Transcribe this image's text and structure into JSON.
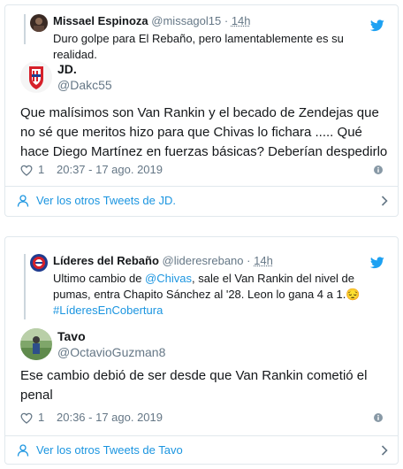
{
  "tweet1": {
    "quoted": {
      "name": "Missael Espinoza",
      "handle": "@missagol15",
      "sep": "·",
      "time": "14h",
      "text": "Duro golpe para El Rebaño, pero lamentablemente es su realidad."
    },
    "author": {
      "name": "JD.",
      "handle": "@Dakc55"
    },
    "text": "Que malísimos son Van Rankin y el becado de Zendejas que no sé que meritos hizo para que Chivas lo fichara .....  Qué hace Diego Martínez en fuerzas básicas?  Deberían despedirlo",
    "likes": "1",
    "datetime": "20:37 - 17 ago. 2019",
    "more_label": "Ver los otros Tweets de JD."
  },
  "tweet2": {
    "quoted": {
      "name": "Líderes del Rebaño",
      "handle": "@lideresrebano",
      "sep": "·",
      "time": "14h",
      "text_before": "Ultimo cambio de ",
      "mention": "@Chivas",
      "text_after": ", sale el Van Rankin del nivel de pumas, entra Chapito Sánchez al '28. Leon lo gana 4 a 1.",
      "emoji": "😔",
      "hashtag": "#LíderesEnCobertura"
    },
    "author": {
      "name": "Tavo",
      "handle": "@OctavioGuzman8"
    },
    "text": "Ese cambio debió de ser desde que Van Rankin cometió el penal",
    "likes": "1",
    "datetime": "20:36 - 17 ago. 2019",
    "more_label": "Ver los otros Tweets de Tavo"
  },
  "colors": {
    "link": "#1b95e0",
    "muted": "#657786",
    "text": "#14171a",
    "border": "#e1e8ed",
    "twitter_blue": "#1da1f2"
  },
  "icons": [
    "twitter-bird-icon",
    "heart-icon",
    "info-icon",
    "person-icon",
    "chevron-right-icon"
  ]
}
